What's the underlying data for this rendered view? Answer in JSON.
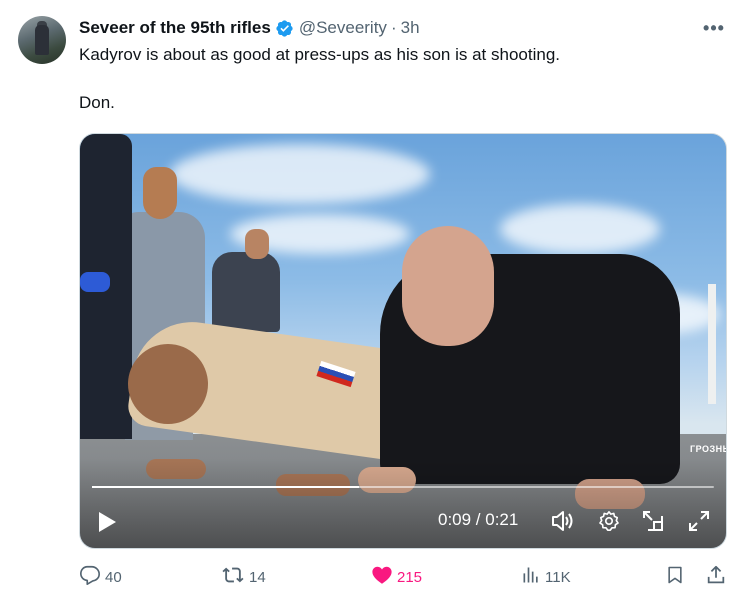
{
  "tweet": {
    "display_name": "Seveer of the 95th rifles",
    "handle": "@Seveerity",
    "separator": "·",
    "time": "3h",
    "more_label": "•••",
    "text_line1": "Kadyrov is about as good at press-ups as his son is at shooting.",
    "text_line2": "Don."
  },
  "video": {
    "watermark": "ГРОЗНЬ",
    "current_time": "0:09",
    "duration": "0:21",
    "time_readout": "0:09 / 0:21",
    "progress": 0.43
  },
  "actions": {
    "replies": "40",
    "reposts": "14",
    "likes": "215",
    "views": "11K"
  },
  "colors": {
    "text": "#0f1419",
    "muted": "#536471",
    "verified": "#1d9bf0",
    "like": "#f91880"
  },
  "icons": [
    "verified-badge-icon",
    "more-icon",
    "play-icon",
    "volume-icon",
    "settings-icon",
    "pip-icon",
    "fullscreen-icon",
    "reply-icon",
    "repost-icon",
    "like-icon",
    "views-icon",
    "bookmark-icon",
    "share-icon"
  ]
}
